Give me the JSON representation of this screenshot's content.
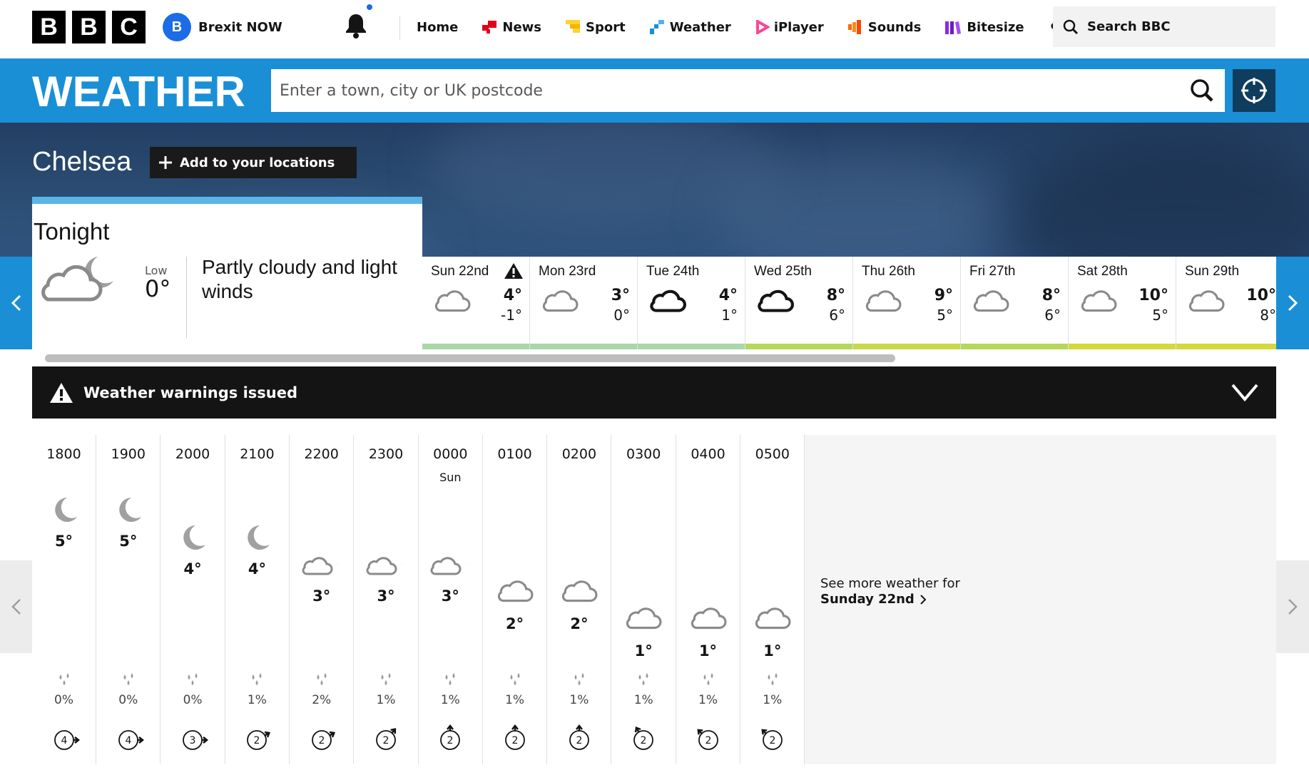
{
  "header": {
    "logo_letters": [
      "B",
      "B",
      "C"
    ],
    "brexit": {
      "badge": "B",
      "label": "Brexit NOW"
    },
    "nav": [
      {
        "label": "Home",
        "icon": "none"
      },
      {
        "label": "News",
        "icon": "news-icon",
        "color": "#e2001a"
      },
      {
        "label": "Sport",
        "icon": "sport-icon",
        "color": "#ffd230"
      },
      {
        "label": "Weather",
        "icon": "weather-icon",
        "color": "#1a8fd6"
      },
      {
        "label": "iPlayer",
        "icon": "iplayer-icon",
        "color": "#f54997"
      },
      {
        "label": "Sounds",
        "icon": "sounds-icon",
        "color": "#ff6600"
      },
      {
        "label": "Bitesize",
        "icon": "bitesize-icon",
        "color": "#8a2be2"
      }
    ],
    "more_label": "•••",
    "search_label": "Search BBC"
  },
  "weather": {
    "title": "WEATHER",
    "search_placeholder": "Enter a town, city or UK postcode"
  },
  "location": {
    "name": "Chelsea",
    "add_label": "Add to your locations"
  },
  "tonight": {
    "label": "Tonight",
    "low_label": "Low",
    "low": "0°",
    "description": "Partly cloudy and light winds"
  },
  "days": [
    {
      "name": "Sun 22nd",
      "high": "4°",
      "low": "-1°",
      "icon": "light-cloud",
      "warning": true,
      "bar": "#a8d8a8"
    },
    {
      "name": "Mon 23rd",
      "high": "3°",
      "low": "0°",
      "icon": "light-cloud",
      "warning": false,
      "bar": "#a8d8a8"
    },
    {
      "name": "Tue 24th",
      "high": "4°",
      "low": "1°",
      "icon": "thick-cloud",
      "warning": false,
      "bar": "#a8d8a8"
    },
    {
      "name": "Wed 25th",
      "high": "8°",
      "low": "6°",
      "icon": "thick-cloud",
      "warning": false,
      "bar": "#b6d85a"
    },
    {
      "name": "Thu 26th",
      "high": "9°",
      "low": "5°",
      "icon": "light-cloud",
      "warning": false,
      "bar": "#c9d84a"
    },
    {
      "name": "Fri 27th",
      "high": "8°",
      "low": "6°",
      "icon": "light-cloud",
      "warning": false,
      "bar": "#b6d85a"
    },
    {
      "name": "Sat 28th",
      "high": "10°",
      "low": "5°",
      "icon": "light-cloud",
      "warning": false,
      "bar": "#d6d83a"
    },
    {
      "name": "Sun 29th",
      "high": "10°",
      "low": "8°",
      "icon": "light-cloud",
      "warning": false,
      "bar": "#d6d83a"
    }
  ],
  "warnings": {
    "label": "Weather warnings issued"
  },
  "hours": [
    {
      "time": "1800",
      "day": "",
      "icon": "moon",
      "temp": "5°",
      "temp_value": 5,
      "rain": "0%",
      "wind": "4",
      "wind_dir": 270
    },
    {
      "time": "1900",
      "day": "",
      "icon": "moon",
      "temp": "5°",
      "temp_value": 5,
      "rain": "0%",
      "wind": "4",
      "wind_dir": 270
    },
    {
      "time": "2000",
      "day": "",
      "icon": "moon",
      "temp": "4°",
      "temp_value": 4,
      "rain": "0%",
      "wind": "3",
      "wind_dir": 270
    },
    {
      "time": "2100",
      "day": "",
      "icon": "moon",
      "temp": "4°",
      "temp_value": 4,
      "rain": "1%",
      "wind": "2",
      "wind_dir": 240
    },
    {
      "time": "2200",
      "day": "",
      "icon": "partly-cloudy-night",
      "temp": "3°",
      "temp_value": 3,
      "rain": "2%",
      "wind": "2",
      "wind_dir": 240
    },
    {
      "time": "2300",
      "day": "",
      "icon": "partly-cloudy-night",
      "temp": "3°",
      "temp_value": 3,
      "rain": "1%",
      "wind": "2",
      "wind_dir": 220
    },
    {
      "time": "0000",
      "day": "Sun",
      "icon": "partly-cloudy-night",
      "temp": "3°",
      "temp_value": 3,
      "rain": "1%",
      "wind": "2",
      "wind_dir": 180
    },
    {
      "time": "0100",
      "day": "",
      "icon": "light-cloud",
      "temp": "2°",
      "temp_value": 2,
      "rain": "1%",
      "wind": "2",
      "wind_dir": 180
    },
    {
      "time": "0200",
      "day": "",
      "icon": "light-cloud",
      "temp": "2°",
      "temp_value": 2,
      "rain": "1%",
      "wind": "2",
      "wind_dir": 180
    },
    {
      "time": "0300",
      "day": "",
      "icon": "light-cloud",
      "temp": "1°",
      "temp_value": 1,
      "rain": "1%",
      "wind": "2",
      "wind_dir": 150
    },
    {
      "time": "0400",
      "day": "",
      "icon": "light-cloud",
      "temp": "1°",
      "temp_value": 1,
      "rain": "1%",
      "wind": "2",
      "wind_dir": 135
    },
    {
      "time": "0500",
      "day": "",
      "icon": "light-cloud",
      "temp": "1°",
      "temp_value": 1,
      "rain": "1%",
      "wind": "2",
      "wind_dir": 135
    }
  ],
  "see_more": {
    "line1": "See more weather for",
    "line2": "Sunday 22nd"
  }
}
